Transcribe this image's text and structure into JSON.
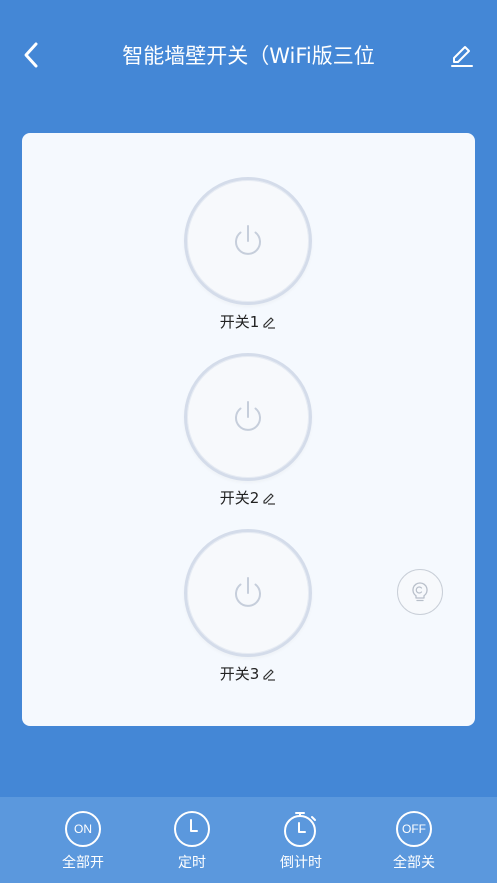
{
  "header": {
    "title": "智能墙壁开关（WiFi版三位",
    "back_icon": "chevron-left-icon",
    "edit_icon": "pencil-icon"
  },
  "switches": [
    {
      "label": "开关1",
      "icon": "power-icon"
    },
    {
      "label": "开关2",
      "icon": "power-icon"
    },
    {
      "label": "开关3",
      "icon": "power-icon"
    }
  ],
  "side_button": {
    "icon": "lightbulb-icon"
  },
  "bottom_bar": {
    "all_on": {
      "icon_text": "ON",
      "label": "全部开"
    },
    "timer": {
      "label": "定时",
      "icon": "clock-icon"
    },
    "countdown": {
      "label": "倒计时",
      "icon": "stopwatch-icon"
    },
    "all_off": {
      "icon_text": "OFF",
      "label": "全部关"
    }
  },
  "colors": {
    "background": "#4487d6",
    "panel": "#f5f9fe",
    "bottom_bar": "#5b98dd",
    "switch_border": "#d4dcea",
    "power_icon": "#c6cedb"
  }
}
